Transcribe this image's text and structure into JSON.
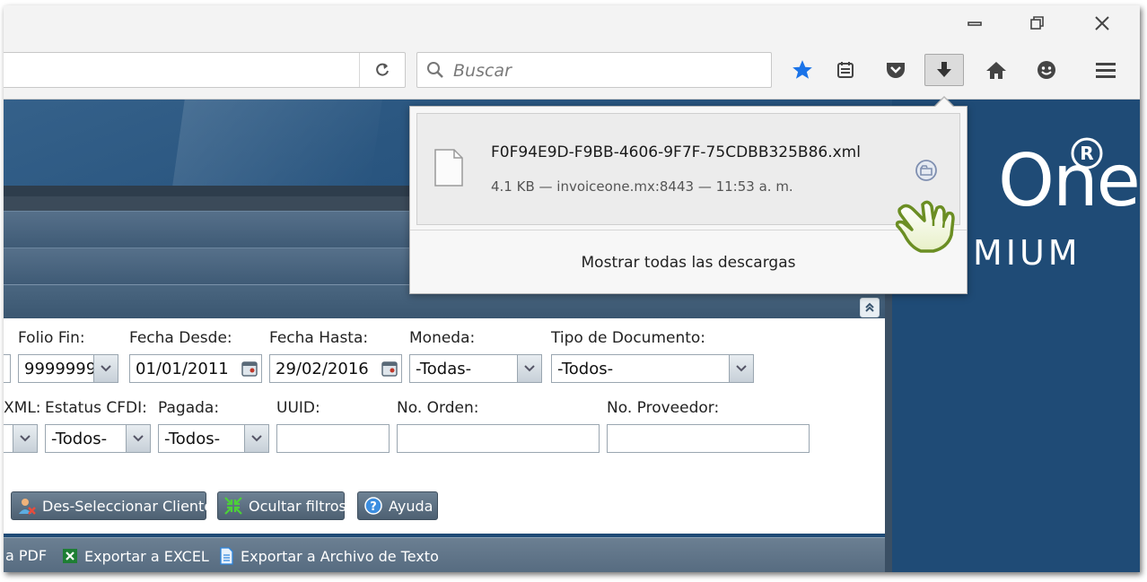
{
  "window": {
    "minimize": "minimize-icon",
    "restore": "restore-icon",
    "close": "close-icon"
  },
  "toolbar": {
    "search_placeholder": "Buscar",
    "icons": [
      "bookmark-star-icon",
      "reading-list-icon",
      "pocket-icon",
      "downloads-icon",
      "home-icon",
      "smiley-icon",
      "menu-icon"
    ],
    "accent_color": "#1a73e8"
  },
  "downloads": {
    "filename": "F0F94E9D-F9BB-4606-9F7F-75CDBB325B86.xml",
    "meta": "4.1 KB — invoiceone.mx:8443 — 11:53 a. m.",
    "show_all": "Mostrar todas las descargas"
  },
  "brand": {
    "logo_text": "One",
    "logo_sub": "MIUM",
    "reg": "®"
  },
  "filters": {
    "row1": {
      "folio_fin": {
        "label": "Folio Fin:",
        "value": "9999999"
      },
      "fecha_desde": {
        "label": "Fecha Desde:",
        "value": "01/01/2011"
      },
      "fecha_hasta": {
        "label": "Fecha Hasta:",
        "value": "29/02/2016"
      },
      "moneda": {
        "label": "Moneda:",
        "value": "-Todas-"
      },
      "tipo_documento": {
        "label": "Tipo de Documento:",
        "value": "-Todos-"
      }
    },
    "row2": {
      "xml": {
        "label": "XML:"
      },
      "estatus_cfdi": {
        "label": "Estatus CFDI:",
        "value": "-Todos-"
      },
      "pagada": {
        "label": "Pagada:",
        "value": "-Todos-"
      },
      "uuid": {
        "label": "UUID:",
        "value": ""
      },
      "no_orden": {
        "label": "No. Orden:",
        "value": ""
      },
      "no_proveedor": {
        "label": "No. Proveedor:",
        "value": ""
      }
    }
  },
  "actions": {
    "deselect_client": "Des-Seleccionar Cliente",
    "hide_filters": "Ocultar filtros",
    "help": "Ayuda"
  },
  "exports": {
    "pdf": "a PDF",
    "excel": "Exportar a EXCEL",
    "text": "Exportar a Archivo de Texto"
  }
}
